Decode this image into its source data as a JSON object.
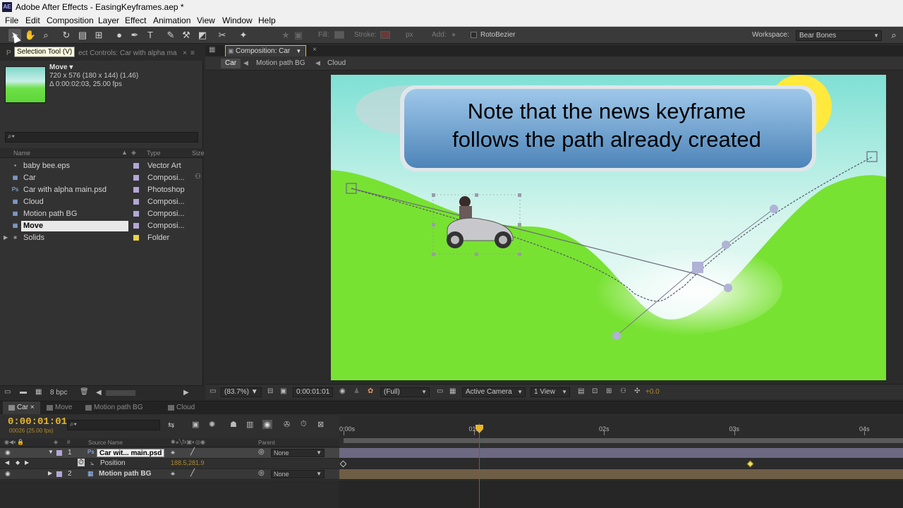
{
  "window": {
    "title": "Adobe After Effects - EasingKeyframes.aep *",
    "app_icon": "AE"
  },
  "menu": [
    "File",
    "Edit",
    "Composition",
    "Layer",
    "Effect",
    "Animation",
    "View",
    "Window",
    "Help"
  ],
  "toolbar": {
    "fill_label": "Fill:",
    "stroke_label": "Stroke:",
    "px_label": "px",
    "add_label": "Add:",
    "rotobezier_label": "RotoBezier",
    "workspace_label": "Workspace:",
    "workspace_value": "Bear Bones",
    "tooltip": "Selection Tool (V)"
  },
  "project": {
    "tab_project": "P",
    "tab_effects": "ect Controls: Car with alpha ma",
    "selected": {
      "name": "Move ▾",
      "dims": "720 x 576  (180 x 144) (1.46)",
      "duration": "Δ 0:00:02:03, 25.00 fps"
    },
    "search_placeholder": "",
    "search_glyph": "⌕▾",
    "col_name": "Name",
    "col_type": "Type",
    "col_size": "Size",
    "items": [
      {
        "name": "baby bee.eps",
        "type": "Vector Art",
        "icon": "vector-file-icon",
        "glyph": "▪",
        "label_color": "#b3a6d6"
      },
      {
        "name": "Car",
        "type": "Composi...",
        "icon": "composition-icon",
        "glyph": "▦",
        "label_color": "#b3a6d6"
      },
      {
        "name": "Car with alpha main.psd",
        "type": "Photoshop",
        "icon": "photoshop-file-icon",
        "glyph": "Ps",
        "label_color": "#b3a6d6"
      },
      {
        "name": "Cloud",
        "type": "Composi...",
        "icon": "composition-icon",
        "glyph": "▦",
        "label_color": "#b3a6d6"
      },
      {
        "name": "Motion path BG",
        "type": "Composi...",
        "icon": "composition-icon",
        "glyph": "▦",
        "label_color": "#b3a6d6"
      },
      {
        "name": "Move",
        "type": "Composi...",
        "icon": "composition-icon",
        "glyph": "▦",
        "label_color": "#b3a6d6"
      },
      {
        "name": "Solids",
        "type": "Folder",
        "icon": "folder-icon",
        "glyph": "■",
        "label_color": "#e8d44a"
      }
    ],
    "footer_bpc": "8 bpc"
  },
  "composition": {
    "tab_label": "Composition: Car",
    "breadcrumbs": [
      "Car",
      "Motion path BG",
      "Cloud"
    ],
    "callout_line1": "Note that the news keyframe",
    "callout_line2": "follows the path already created",
    "footer": {
      "zoom": "(83.7%)",
      "timecode": "0:00:01:01",
      "resolution": "(Full)",
      "camera": "Active Camera",
      "views": "1 View",
      "exposure": "+0.0"
    }
  },
  "timeline": {
    "tabs": [
      "Car",
      "Move",
      "Motion path BG",
      "Cloud"
    ],
    "timecode": "0:00:01:01",
    "timecode_sub": "00026 (25.00 fps)",
    "ruler_labels": [
      "0:00s",
      "01s",
      "02s",
      "03s",
      "04s"
    ],
    "ruler_start_s": 0,
    "ruler_end_s": 4,
    "playhead_s": 1.04,
    "col_source": "Source Name",
    "col_parent": "Parent",
    "layers": [
      {
        "index": "1",
        "name": "Car wit... main.psd",
        "parent": "None"
      },
      {
        "index": "2",
        "name": "Motion path BG",
        "parent": "None"
      }
    ],
    "property": {
      "name": "Position",
      "value": "188.5,281.9"
    },
    "keyframes_s": [
      0,
      3.13
    ]
  },
  "colors": {
    "accent": "#e5b52e",
    "playhead": "#d63030",
    "sky": "#8fe6d8",
    "grass": "#74e031",
    "layer1_bar": "#6d6982",
    "layer2_bar": "#6e5e46"
  }
}
